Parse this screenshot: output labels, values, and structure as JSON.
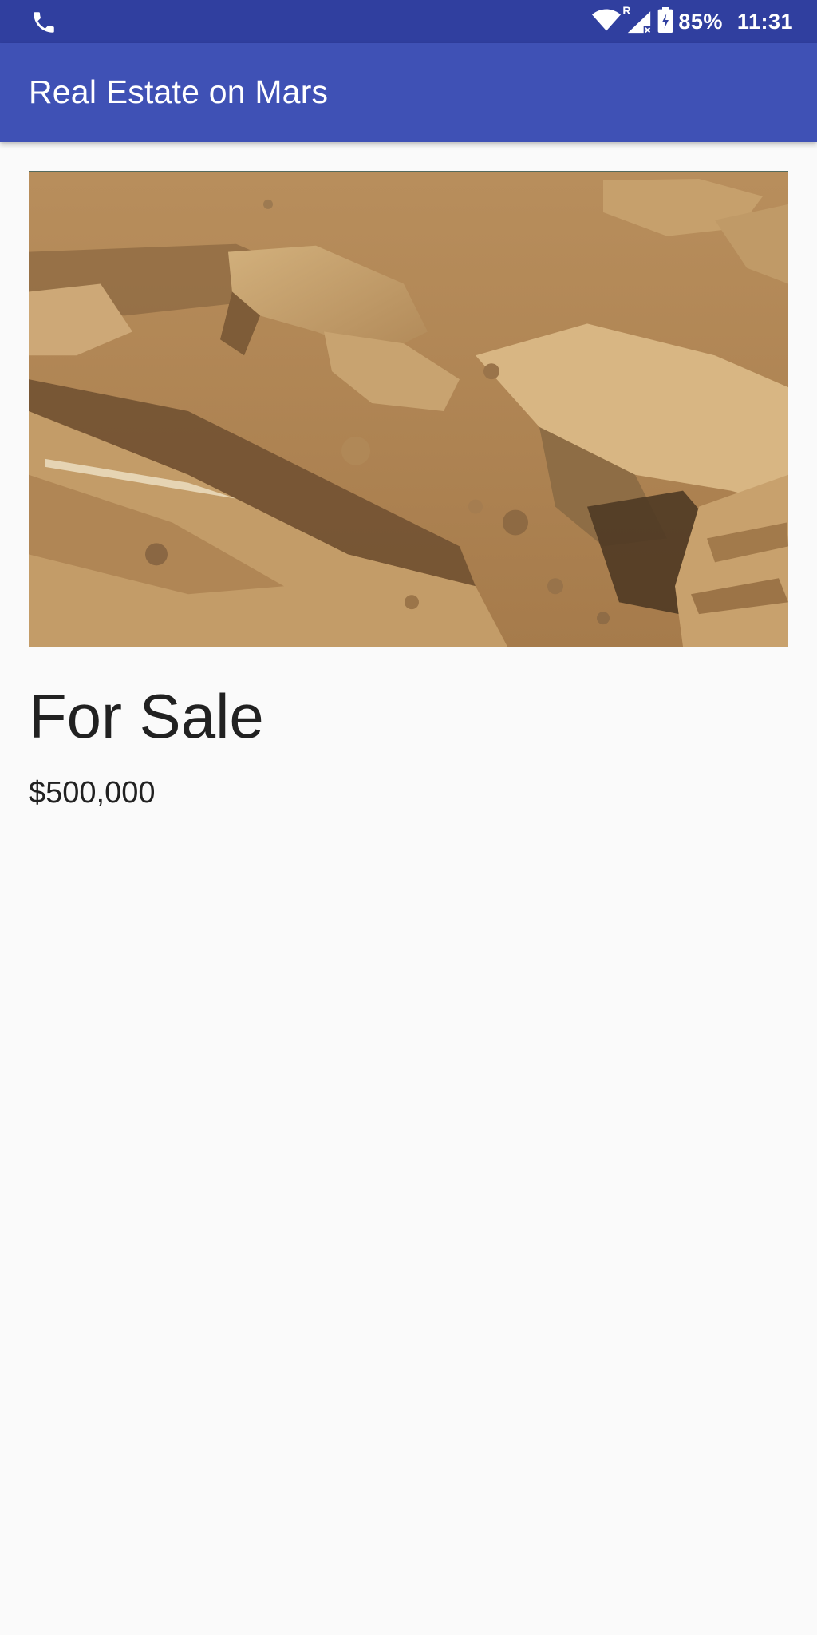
{
  "status_bar": {
    "battery_percent": "85%",
    "time": "11:31",
    "signal_roaming_label": "R",
    "left_icon": "phone-icon",
    "right_icons": [
      "wifi-icon",
      "cell-signal-icon",
      "battery-charging-icon"
    ],
    "background_color": "#303f9f"
  },
  "app_bar": {
    "title": "Real Estate on Mars",
    "background_color": "#3f51b5"
  },
  "listing": {
    "image_subject": "mars-terrain-photo",
    "title": "For Sale",
    "price": "$500,000"
  }
}
